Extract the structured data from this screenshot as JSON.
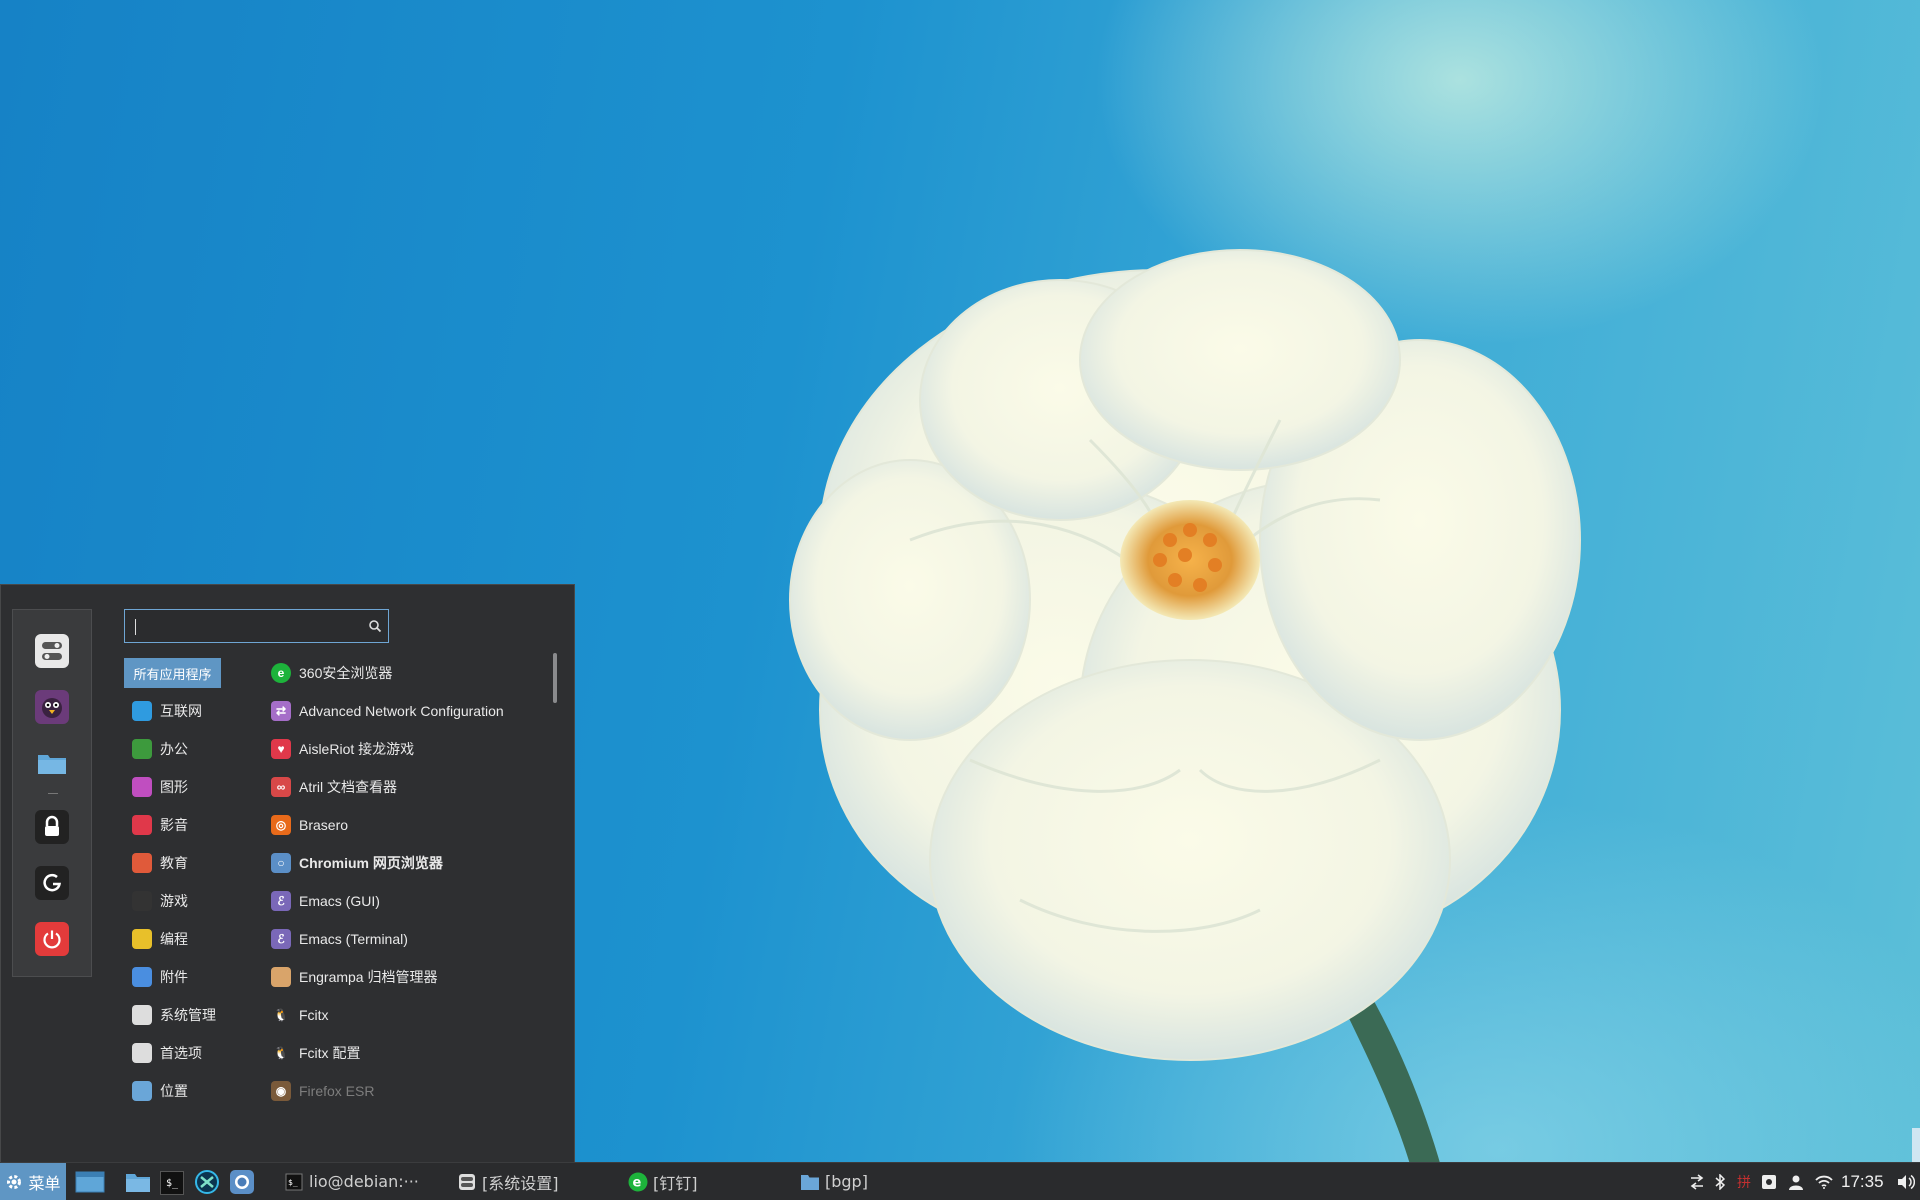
{
  "menu": {
    "search": {
      "value": "",
      "placeholder": ""
    },
    "favorites": [
      {
        "name": "settings-toggle-icon"
      },
      {
        "name": "penguin-chat-icon"
      },
      {
        "name": "folder-icon"
      },
      {
        "name": "lock-icon"
      },
      {
        "name": "logout-icon"
      },
      {
        "name": "power-icon"
      }
    ],
    "categories": [
      {
        "label": "所有应用程序",
        "selected": true
      },
      {
        "label": "互联网",
        "icon": "cloud-icon",
        "color": "#2f9be0"
      },
      {
        "label": "办公",
        "icon": "office-icon",
        "color": "#3d9a3d"
      },
      {
        "label": "图形",
        "icon": "graphics-icon",
        "color": "#c04ec0"
      },
      {
        "label": "影音",
        "icon": "media-play-icon",
        "color": "#e0384a"
      },
      {
        "label": "教育",
        "icon": "education-icon",
        "color": "#e05a3a"
      },
      {
        "label": "游戏",
        "icon": "game-controller-icon",
        "color": "#333333"
      },
      {
        "label": "编程",
        "icon": "programming-icon",
        "color": "#e8c02a"
      },
      {
        "label": "附件",
        "icon": "accessories-scissors-icon",
        "color": "#4a8ee0"
      },
      {
        "label": "系统管理",
        "icon": "system-admin-icon",
        "color": "#dddddd"
      },
      {
        "label": "首选项",
        "icon": "preferences-icon",
        "color": "#dddddd"
      },
      {
        "label": "位置",
        "icon": "places-folder-icon",
        "color": "#6aa6d8"
      }
    ],
    "apps": [
      {
        "label": "360安全浏览器",
        "icon": "360-browser-icon",
        "color": "#1db33b",
        "glyph": "e"
      },
      {
        "label": "Advanced Network Configuration",
        "icon": "network-config-icon",
        "color": "#a56ec8",
        "glyph": "⇄"
      },
      {
        "label": "AisleRiot 接龙游戏",
        "icon": "aisleriot-cards-icon",
        "color": "#e0384a",
        "glyph": "♥"
      },
      {
        "label": "Atril 文档查看器",
        "icon": "atril-viewer-icon",
        "color": "#d84848",
        "glyph": "∞"
      },
      {
        "label": "Brasero",
        "icon": "brasero-disc-icon",
        "color": "#e86a1a",
        "glyph": "◎"
      },
      {
        "label": "Chromium 网页浏览器",
        "icon": "chromium-icon",
        "color": "#5b8fc7",
        "glyph": "○",
        "bold": true
      },
      {
        "label": "Emacs (GUI)",
        "icon": "emacs-icon",
        "color": "#7a68b8",
        "glyph": "ℰ"
      },
      {
        "label": "Emacs (Terminal)",
        "icon": "emacs-terminal-icon",
        "color": "#7a68b8",
        "glyph": "ℰ"
      },
      {
        "label": "Engrampa 归档管理器",
        "icon": "engrampa-archive-icon",
        "color": "#d9a46a",
        "glyph": ""
      },
      {
        "label": "Fcitx",
        "icon": "fcitx-penguin-icon",
        "color": "transparent",
        "glyph": "🐧"
      },
      {
        "label": "Fcitx 配置",
        "icon": "fcitx-config-penguin-icon",
        "color": "transparent",
        "glyph": "🐧"
      },
      {
        "label": "Firefox ESR",
        "icon": "firefox-icon",
        "color": "#7a5a3a",
        "glyph": "◉",
        "dim": true
      }
    ]
  },
  "taskbar": {
    "menu_label": "菜单",
    "launchers": [
      "show-desktop-icon",
      "file-manager-icon",
      "terminal-icon",
      "dev-tool-icon",
      "chromium-launcher-icon"
    ],
    "windows": [
      {
        "label": "lio@debian:···",
        "icon": "terminal-icon"
      },
      {
        "label": "[系统设置]",
        "icon": "system-settings-icon"
      },
      {
        "label": "[钉钉]",
        "icon": "360-browser-icon"
      },
      {
        "label": "[bgp]",
        "icon": "folder-icon"
      }
    ],
    "tray": [
      "network-arrows-icon",
      "bluetooth-icon",
      "input-method-pinyin-icon",
      "screenshot-icon",
      "user-icon",
      "wifi-icon"
    ],
    "tray_ime_label": "拼",
    "clock": "17:35",
    "volume": "volume-icon"
  },
  "colors": {
    "accent": "#5f96c4",
    "panel": "#2e2f31",
    "taskbar": "#2a2b2d"
  }
}
